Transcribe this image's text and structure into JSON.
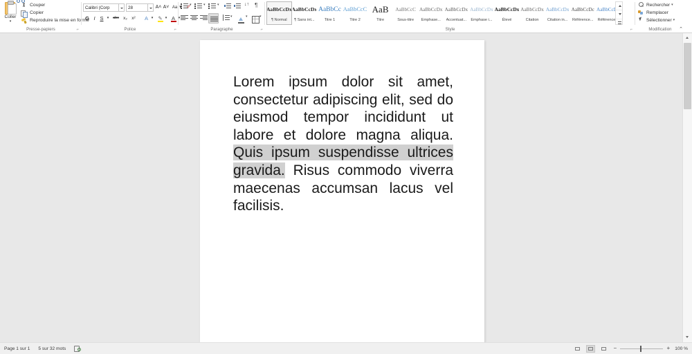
{
  "ribbon": {
    "clipboard": {
      "group_label": "Presse-papiers",
      "paste_label": "Coller",
      "commands": [
        {
          "label": "Couper",
          "icon": "scissors-icon"
        },
        {
          "label": "Copier",
          "icon": "copy-icon"
        },
        {
          "label": "Reproduire la mise en forme",
          "icon": "format-painter-icon"
        }
      ]
    },
    "font": {
      "group_label": "Police",
      "font_name": "Calibri (Corp",
      "font_size": "28",
      "buttons_row1": [
        {
          "name": "grow-font",
          "glyph": "A˄"
        },
        {
          "name": "shrink-font",
          "glyph": "A˅"
        },
        {
          "name": "change-case",
          "glyph": "Aa"
        },
        {
          "name": "clear-formatting",
          "glyph": "✐"
        }
      ],
      "buttons_row2": [
        {
          "name": "bold",
          "glyph": "G"
        },
        {
          "name": "italic",
          "glyph": "I"
        },
        {
          "name": "underline",
          "glyph": "S"
        },
        {
          "name": "strikethrough",
          "glyph": "abc"
        },
        {
          "name": "subscript",
          "glyph": "x₂"
        },
        {
          "name": "superscript",
          "glyph": "x²"
        },
        {
          "name": "text-effects",
          "glyph": "A"
        },
        {
          "name": "text-highlight",
          "glyph": "✎"
        },
        {
          "name": "font-color",
          "glyph": "A"
        }
      ],
      "highlight_color": "#ffe400",
      "font_color": "#c00000"
    },
    "paragraph": {
      "group_label": "Paragraphe",
      "row1": [
        "bullets",
        "numbering",
        "multilevel-list",
        "decrease-indent",
        "increase-indent",
        "sort",
        "show-marks"
      ],
      "row2": [
        "align-left",
        "align-center",
        "align-right",
        "justify",
        "line-spacing",
        "shading",
        "borders"
      ],
      "active": "justify"
    },
    "styles": {
      "group_label": "Style",
      "items": [
        {
          "sample": "AaBbCcDx",
          "name": "¶ Normal",
          "color": "#2b2b2b",
          "bold": true,
          "size": 7.6,
          "active": true
        },
        {
          "sample": "AaBbCcDx",
          "name": "¶ Sans int...",
          "color": "#2b2b2b",
          "bold": true,
          "size": 7.6,
          "active": false
        },
        {
          "sample": "AaBbCc",
          "name": "Titre 1",
          "color": "#3a7ebf",
          "bold": false,
          "size": 9.5,
          "active": false
        },
        {
          "sample": "AaBbCcC",
          "name": "Titre 2",
          "color": "#5f9fd4",
          "bold": false,
          "size": 8.4,
          "active": false
        },
        {
          "sample": "AaB",
          "name": "Titre",
          "color": "#1a1a1a",
          "bold": false,
          "size": 13,
          "active": false
        },
        {
          "sample": "AaBbCcC",
          "name": "Sous-titre",
          "color": "#777777",
          "bold": false,
          "size": 7.2,
          "active": false
        },
        {
          "sample": "AaBbCcDx",
          "name": "Emphase...",
          "color": "#6a6a6a",
          "bold": false,
          "size": 7.2,
          "active": false
        },
        {
          "sample": "AaBbCcDx",
          "name": "Accentuat...",
          "color": "#5a5a5a",
          "bold": false,
          "size": 7.2,
          "active": false
        },
        {
          "sample": "AaBbCcDx",
          "name": "Emphase i...",
          "color": "#9ab5cf",
          "bold": false,
          "size": 7.2,
          "active": false
        },
        {
          "sample": "AaBbCcDx",
          "name": "Élevé",
          "color": "#1a1a1a",
          "bold": true,
          "size": 7.4,
          "active": false
        },
        {
          "sample": "AaBbCcDx",
          "name": "Citation",
          "color": "#6a6a6a",
          "bold": false,
          "size": 7.2,
          "active": false
        },
        {
          "sample": "AaBbCcDx",
          "name": "Citation in...",
          "color": "#6f9fd0",
          "bold": false,
          "size": 7.2,
          "active": false
        },
        {
          "sample": "AaBbCcDc",
          "name": "Référence...",
          "color": "#4a4a4a",
          "bold": false,
          "size": 7.2,
          "active": false
        },
        {
          "sample": "AaBbCcDx",
          "name": "Référence...",
          "color": "#4a86c8",
          "bold": false,
          "size": 7.2,
          "active": false
        }
      ],
      "nav": [
        "scroll-up",
        "scroll-down",
        "more-styles"
      ]
    },
    "editing": {
      "group_label": "Modification",
      "commands": [
        {
          "label": "Rechercher",
          "icon": "search-icon",
          "has_arrow": true
        },
        {
          "label": "Remplacer",
          "icon": "replace-icon",
          "has_arrow": false
        },
        {
          "label": "Sélectionner",
          "icon": "select-icon",
          "has_arrow": true
        }
      ],
      "collapse_glyph": "⌃"
    }
  },
  "document": {
    "before_selection": "Lorem ipsum dolor sit amet, consectetur adipiscing elit, sed do eiusmod tempor incididunt ut labore et dolore magna aliqua. ",
    "selection": "Quis ipsum suspendisse ultrices gravida.",
    "after_selection": " Risus commodo viverra maecenas accumsan lacus vel facilisis.",
    "selection_color": "#d0d0d0"
  },
  "status": {
    "page": "Page 1 sur 1",
    "words": "5 sur 32 mots",
    "proofing_icon": "proofing-icon",
    "views": [
      {
        "name": "read-mode",
        "active": false
      },
      {
        "name": "print-layout",
        "active": true
      },
      {
        "name": "web-layout",
        "active": false
      }
    ],
    "zoom_out": "−",
    "zoom_in": "+",
    "zoom_value": "100 %"
  }
}
